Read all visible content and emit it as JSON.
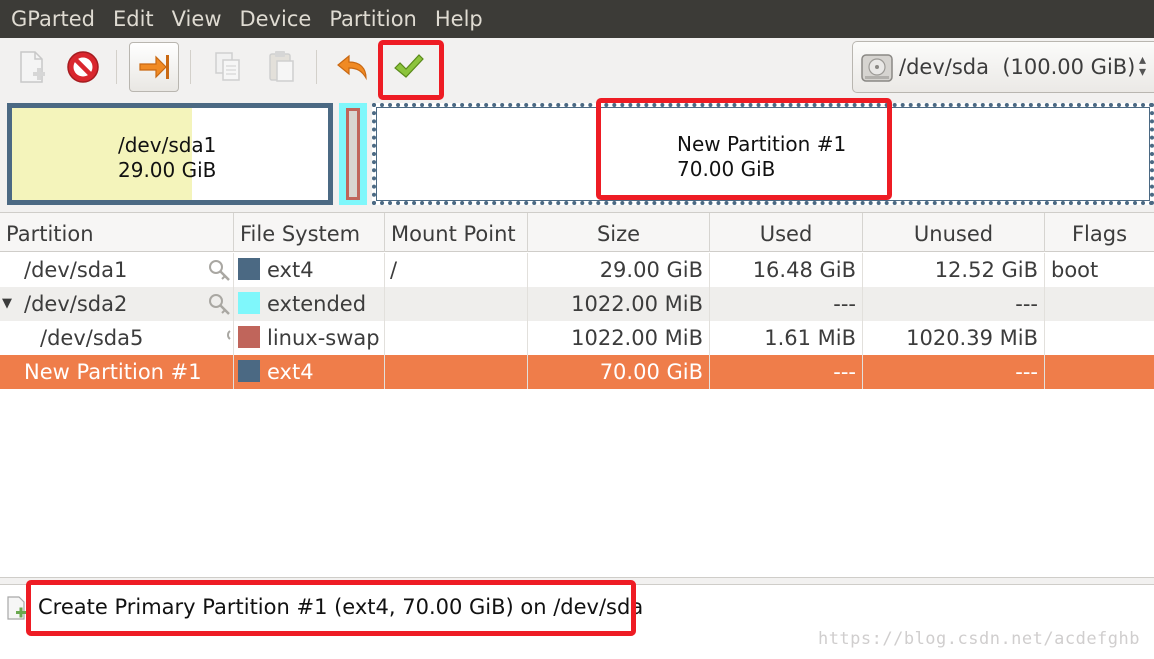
{
  "menu": [
    "GParted",
    "Edit",
    "View",
    "Device",
    "Partition",
    "Help"
  ],
  "device_selector": {
    "label": "/dev/sda  (100.00 GiB)"
  },
  "disk_map": {
    "sda1": {
      "name": "/dev/sda1",
      "size": "29.00 GiB",
      "used_fraction": 0.57
    },
    "new_partition": {
      "name": "New Partition #1",
      "size": "70.00 GiB"
    }
  },
  "table": {
    "headers": [
      "Partition",
      "File System",
      "Mount Point",
      "Size",
      "Used",
      "Unused",
      "Flags"
    ],
    "rows": [
      {
        "partition": "/dev/sda1",
        "fs": "ext4",
        "fs_color": "#4b6983",
        "mount": "/",
        "size": "29.00 GiB",
        "used": "16.48 GiB",
        "unused": "12.52 GiB",
        "flags": "boot"
      },
      {
        "partition": "/dev/sda2",
        "fs": "extended",
        "fs_color": "#7ff7fb",
        "mount": "",
        "size": "1022.00 MiB",
        "used": "---",
        "unused": "---",
        "flags": ""
      },
      {
        "partition": "/dev/sda5",
        "fs": "linux-swap",
        "fs_color": "#c0655b",
        "mount": "",
        "size": "1022.00 MiB",
        "used": "1.61 MiB",
        "unused": "1020.39 MiB",
        "flags": ""
      },
      {
        "partition": "New Partition #1",
        "fs": "ext4",
        "fs_color": "#4b6983",
        "mount": "",
        "size": "70.00 GiB",
        "used": "---",
        "unused": "---",
        "flags": ""
      }
    ]
  },
  "operations": [
    {
      "text": "Create Primary Partition #1 (ext4, 70.00 GiB) on /dev/sda"
    }
  ],
  "watermark": "https://blog.csdn.net/acdefghb",
  "colors": {
    "selection": "#ef7d4a",
    "highlight_box": "#ee1c24",
    "menubar": "#3c3b37"
  }
}
